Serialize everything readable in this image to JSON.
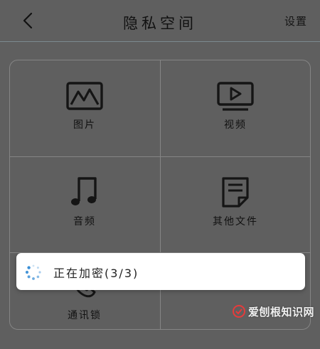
{
  "header": {
    "back_icon": "chevron-left-icon",
    "title": "隐私空间",
    "settings_label": "设置"
  },
  "grid": {
    "items": [
      {
        "label": "图片",
        "icon": "image-icon"
      },
      {
        "label": "视频",
        "icon": "video-icon"
      },
      {
        "label": "音频",
        "icon": "music-note-icon"
      },
      {
        "label": "其他文件",
        "icon": "document-icon"
      },
      {
        "label": "通讯锁",
        "icon": "phone-lock-icon"
      }
    ]
  },
  "toast": {
    "text": "正在加密(3/3)",
    "icon": "loading-spinner-icon"
  },
  "watermark": {
    "text": "爱刨根知识网"
  },
  "colors": {
    "background": "#5f5f5f",
    "toast": "#ffffff",
    "line": "#858585"
  }
}
